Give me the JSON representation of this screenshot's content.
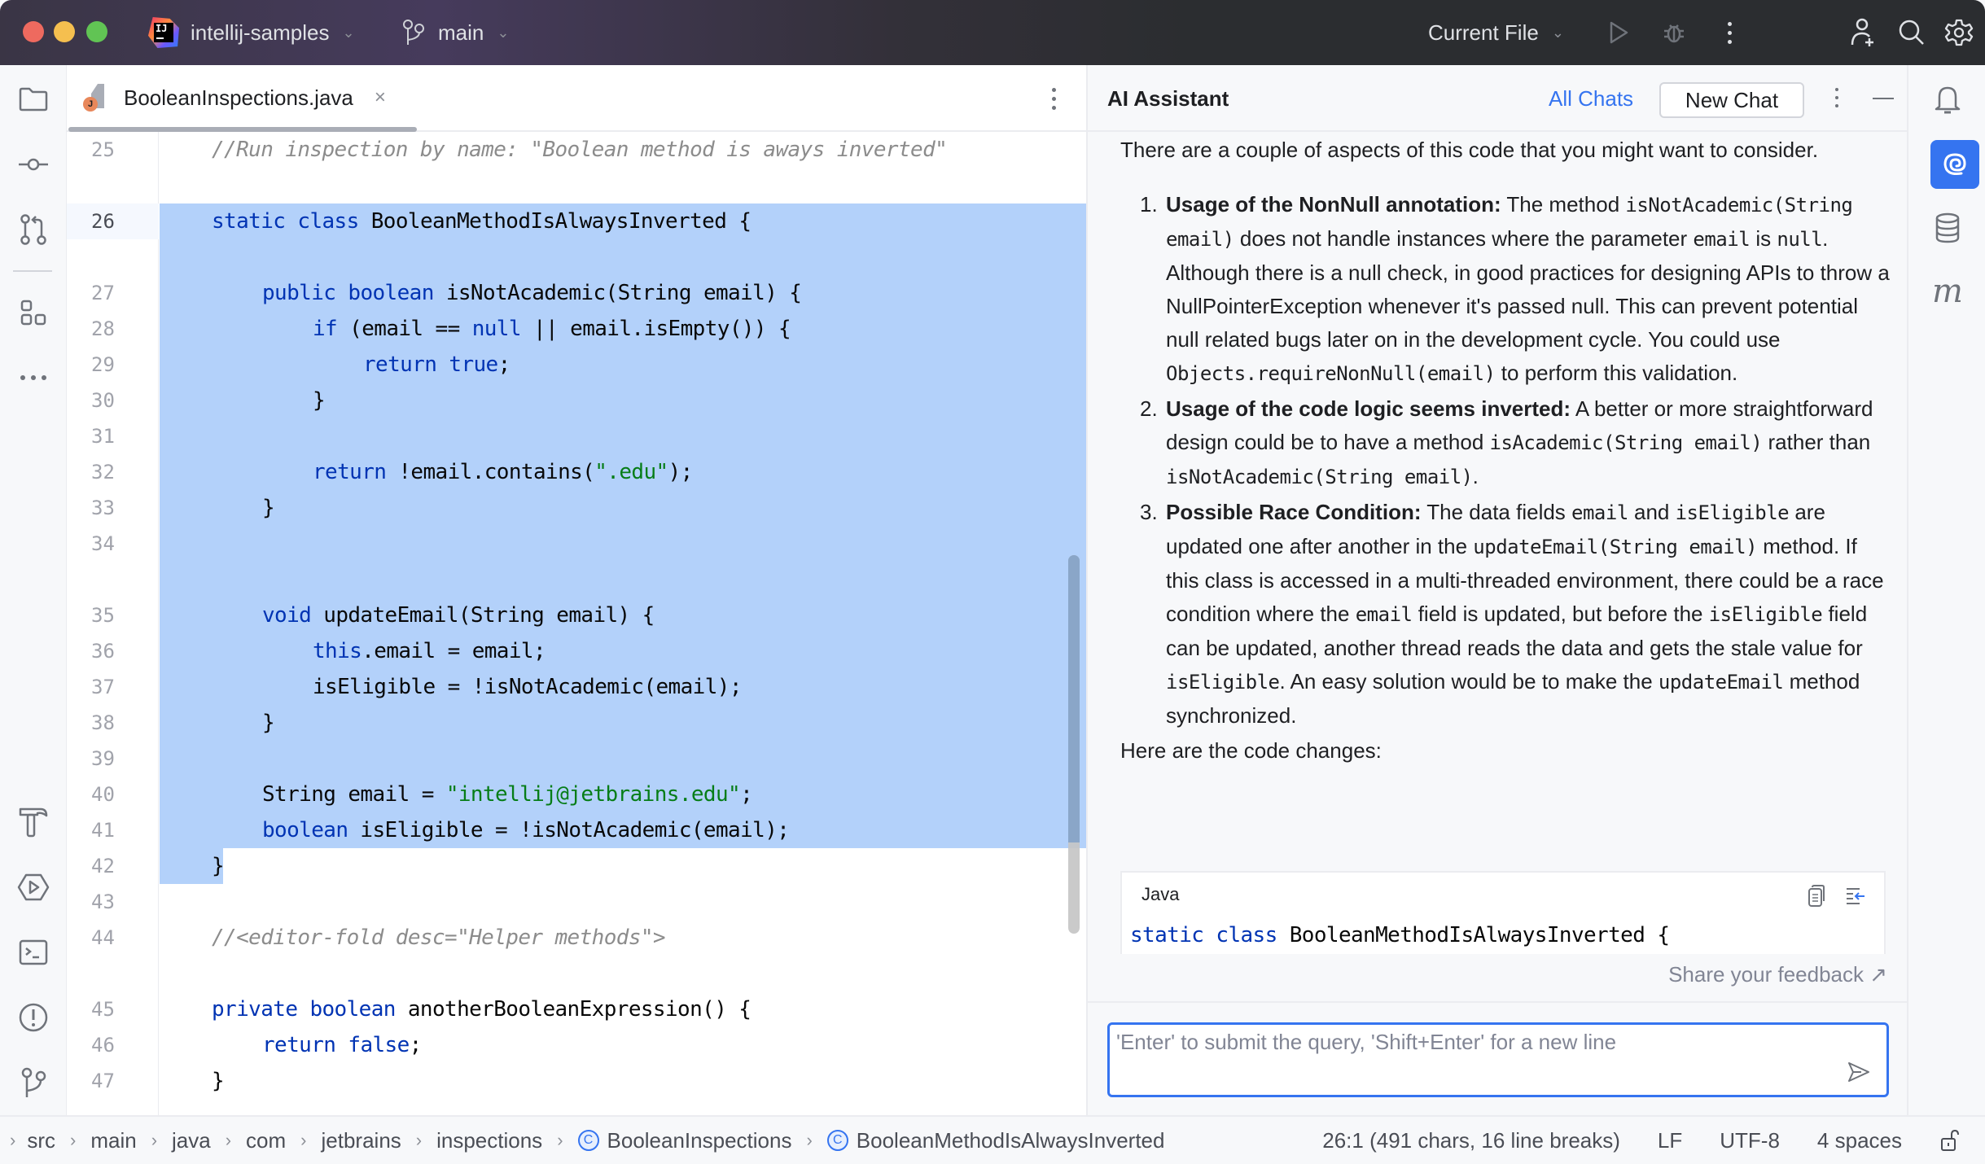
{
  "window": {
    "project_name": "intellij-samples",
    "branch": "main",
    "run_config": "Current File",
    "icons": [
      "intellij-logo-icon",
      "branch-icon",
      "run-icon",
      "debug-icon",
      "more-vertical-icon",
      "add-user-icon",
      "search-icon",
      "settings-gear-icon"
    ]
  },
  "left_toolbar": {
    "top": [
      {
        "name": "project-folder-icon",
        "label": "Project"
      },
      {
        "name": "commit-icon",
        "label": "Commit"
      },
      {
        "name": "pull-requests-icon",
        "label": "Pull Requests"
      },
      {
        "name": "structure-icon",
        "label": "Structure"
      },
      {
        "name": "more-tools-icon",
        "label": "More"
      }
    ],
    "bottom": [
      {
        "name": "build-hammer-icon",
        "label": "Build"
      },
      {
        "name": "services-run-icon",
        "label": "Services"
      },
      {
        "name": "terminal-icon",
        "label": "Terminal"
      },
      {
        "name": "problems-icon",
        "label": "Problems"
      },
      {
        "name": "git-icon",
        "label": "Git"
      }
    ]
  },
  "editor": {
    "tab": {
      "filename": "BooleanInspections.java",
      "file_type_badge": "J"
    },
    "lines": [
      {
        "num": "25",
        "indent": 1,
        "tokens": [
          {
            "t": "//Run inspection by name: \"Boolean method is aways inverted\"",
            "c": "cm"
          }
        ],
        "selected": false
      },
      {
        "num": "26",
        "indent": 1,
        "tokens": [
          {
            "t": "static",
            "c": "kw"
          },
          {
            "t": " "
          },
          {
            "t": "class",
            "c": "kw"
          },
          {
            "t": " BooleanMethodIsAlwaysInverted {"
          }
        ],
        "selected": true,
        "current": true
      },
      {
        "num": "27",
        "indent": 2,
        "tokens": [
          {
            "t": "public",
            "c": "kw"
          },
          {
            "t": " "
          },
          {
            "t": "boolean",
            "c": "kw"
          },
          {
            "t": " isNotAcademic(String email) {"
          }
        ],
        "selected": true
      },
      {
        "num": "28",
        "indent": 3,
        "tokens": [
          {
            "t": "if",
            "c": "kw"
          },
          {
            "t": " (email == "
          },
          {
            "t": "null",
            "c": "kw"
          },
          {
            "t": " || email.isEmpty()) {"
          }
        ],
        "selected": true
      },
      {
        "num": "29",
        "indent": 4,
        "tokens": [
          {
            "t": "return",
            "c": "kw"
          },
          {
            "t": " "
          },
          {
            "t": "true",
            "c": "kw"
          },
          {
            "t": ";"
          }
        ],
        "selected": true
      },
      {
        "num": "30",
        "indent": 3,
        "tokens": [
          {
            "t": "}"
          }
        ],
        "selected": true
      },
      {
        "num": "31",
        "indent": 0,
        "tokens": [],
        "selected": true
      },
      {
        "num": "32",
        "indent": 3,
        "tokens": [
          {
            "t": "return",
            "c": "kw"
          },
          {
            "t": " !email.contains("
          },
          {
            "t": "\".edu\"",
            "c": "str"
          },
          {
            "t": ");"
          }
        ],
        "selected": true
      },
      {
        "num": "33",
        "indent": 2,
        "tokens": [
          {
            "t": "}"
          }
        ],
        "selected": true
      },
      {
        "num": "34",
        "indent": 0,
        "tokens": [],
        "selected": true
      },
      {
        "num": "35",
        "indent": 2,
        "tokens": [
          {
            "t": "void",
            "c": "kw"
          },
          {
            "t": " updateEmail(String email) {"
          }
        ],
        "selected": true
      },
      {
        "num": "36",
        "indent": 3,
        "tokens": [
          {
            "t": "this",
            "c": "kw"
          },
          {
            "t": ".email = email;"
          }
        ],
        "selected": true
      },
      {
        "num": "37",
        "indent": 3,
        "tokens": [
          {
            "t": "isEligible = !isNotAcademic(email);"
          }
        ],
        "selected": true
      },
      {
        "num": "38",
        "indent": 2,
        "tokens": [
          {
            "t": "}"
          }
        ],
        "selected": true
      },
      {
        "num": "39",
        "indent": 0,
        "tokens": [],
        "selected": true
      },
      {
        "num": "40",
        "indent": 2,
        "tokens": [
          {
            "t": "String email = "
          },
          {
            "t": "\"intellij@jetbrains.edu\"",
            "c": "str"
          },
          {
            "t": ";"
          }
        ],
        "selected": true
      },
      {
        "num": "41",
        "indent": 2,
        "tokens": [
          {
            "t": "boolean",
            "c": "kw"
          },
          {
            "t": " isEligible = !isNotAcademic(email);"
          }
        ],
        "selected": true
      },
      {
        "num": "42",
        "indent": 1,
        "tokens": [
          {
            "t": "}"
          }
        ],
        "selected": "partial"
      },
      {
        "num": "43",
        "indent": 0,
        "tokens": [],
        "selected": false
      },
      {
        "num": "44",
        "indent": 1,
        "tokens": [
          {
            "t": "//<editor-fold desc=\"Helper methods\">",
            "c": "cm"
          }
        ],
        "selected": false
      },
      {
        "num": "45",
        "indent": 1,
        "tokens": [
          {
            "t": "private",
            "c": "kw"
          },
          {
            "t": " "
          },
          {
            "t": "boolean",
            "c": "kw"
          },
          {
            "t": " anotherBooleanExpression() {"
          }
        ],
        "selected": false
      },
      {
        "num": "46",
        "indent": 2,
        "tokens": [
          {
            "t": "return",
            "c": "kw"
          },
          {
            "t": " "
          },
          {
            "t": "false",
            "c": "kw"
          },
          {
            "t": ";"
          }
        ],
        "selected": false
      },
      {
        "num": "47",
        "indent": 1,
        "tokens": [
          {
            "t": "}"
          }
        ],
        "selected": false
      }
    ]
  },
  "ai_assistant": {
    "title": "AI Assistant",
    "all_chats_label": "All Chats",
    "new_chat_label": "New Chat",
    "intro": "There are a couple of aspects of this code that you might want to consider.",
    "points": [
      {
        "number": "1.",
        "heading": "Usage of the NonNull annotation:",
        "parts": [
          {
            "t": " The method "
          },
          {
            "t": "isNotAcademic(String email)",
            "code": true
          },
          {
            "t": " does not handle instances where the parameter "
          },
          {
            "t": "email",
            "code": true
          },
          {
            "t": " is "
          },
          {
            "t": "null",
            "code": true
          },
          {
            "t": ". Although there is a null check, in good practices for designing APIs to throw a NullPointerException whenever it's passed null. This can prevent potential null related bugs later on in the development cycle. You could use "
          },
          {
            "t": "Objects.requireNonNull(email)",
            "code": true
          },
          {
            "t": " to perform this validation."
          }
        ]
      },
      {
        "number": "2.",
        "heading": "Usage of the code logic seems inverted:",
        "parts": [
          {
            "t": " A better or more straightforward design could be to have a method "
          },
          {
            "t": "isAcademic(String email)",
            "code": true
          },
          {
            "t": " rather than "
          },
          {
            "t": "isNotAcademic(String email)",
            "code": true
          },
          {
            "t": "."
          }
        ]
      },
      {
        "number": "3.",
        "heading": "Possible Race Condition:",
        "parts": [
          {
            "t": " The data fields "
          },
          {
            "t": "email",
            "code": true
          },
          {
            "t": " and "
          },
          {
            "t": "isEligible",
            "code": true
          },
          {
            "t": " are updated one after another in the "
          },
          {
            "t": "updateEmail(String email)",
            "code": true
          },
          {
            "t": " method. If this class is accessed in a multi-threaded environment, there could be a race condition where the "
          },
          {
            "t": "email",
            "code": true
          },
          {
            "t": " field is updated, but before the "
          },
          {
            "t": "isEligible",
            "code": true
          },
          {
            "t": " field can be updated, another thread reads the data and gets the stale value for "
          },
          {
            "t": "isEligible",
            "code": true
          },
          {
            "t": ". An easy solution would be to make the "
          },
          {
            "t": "updateEmail",
            "code": true
          },
          {
            "t": " method synchronized."
          }
        ]
      }
    ],
    "code_changes_intro": "Here are the code changes:",
    "code_block": {
      "language": "Java",
      "tokens": [
        {
          "t": "static",
          "c": "kw"
        },
        {
          "t": " "
        },
        {
          "t": "class",
          "c": "kw"
        },
        {
          "t": " BooleanMethodIsAlwaysInverted {"
        }
      ]
    },
    "feedback_label": "Share your feedback ↗",
    "input_placeholder": "'Enter' to submit the query, 'Shift+Enter' for a new line",
    "input_value": ""
  },
  "right_toolbar": [
    {
      "name": "notifications-bell-icon",
      "label": "Notifications"
    },
    {
      "name": "ai-assistant-spiral-icon",
      "label": "AI Assistant",
      "active": true
    },
    {
      "name": "database-icon",
      "label": "Database"
    },
    {
      "name": "maven-icon",
      "label": "Maven"
    }
  ],
  "status_bar": {
    "breadcrumbs": [
      {
        "label": "src"
      },
      {
        "label": "main"
      },
      {
        "label": "java"
      },
      {
        "label": "com"
      },
      {
        "label": "jetbrains"
      },
      {
        "label": "inspections"
      },
      {
        "label": "BooleanInspections",
        "class_icon": true
      },
      {
        "label": "BooleanMethodIsAlwaysInverted",
        "class_icon": true
      }
    ],
    "cursor_info": "26:1 (491 chars, 16 line breaks)",
    "line_separator": "LF",
    "encoding": "UTF-8",
    "indent": "4 spaces"
  },
  "colors": {
    "accent": "#3574f0",
    "selection": "#b3d1fa",
    "keyword": "#0033b3",
    "string": "#067d17",
    "comment": "#8c8c8c"
  }
}
